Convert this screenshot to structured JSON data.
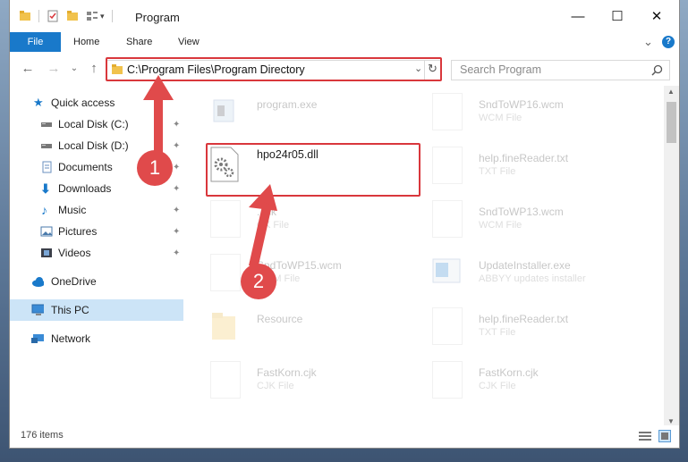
{
  "window": {
    "title": "Program",
    "controls": {
      "minimize": "—",
      "maximize": "☐",
      "close": "✕"
    }
  },
  "ribbon": {
    "tabs": [
      "File",
      "Home",
      "Share",
      "View"
    ],
    "help": "?",
    "expand": "⌄"
  },
  "navigation": {
    "back": "←",
    "forward": "→",
    "recent": "⌄",
    "up": "↑",
    "address": "C:\\Program Files\\Program Directory",
    "refresh": "↻",
    "address_dropdown": "⌄",
    "search_placeholder": "Search Program"
  },
  "sidebar": {
    "items": [
      {
        "label": "Quick access",
        "icon": "star-icon"
      },
      {
        "label": "Local Disk (C:)",
        "icon": "drive-icon",
        "pinned": true
      },
      {
        "label": "Local Disk (D:)",
        "icon": "drive-icon",
        "pinned": true
      },
      {
        "label": "Documents",
        "icon": "documents-icon",
        "pinned": true
      },
      {
        "label": "Downloads",
        "icon": "download-arrow-icon",
        "pinned": true
      },
      {
        "label": "Music",
        "icon": "music-note-icon",
        "pinned": true
      },
      {
        "label": "Pictures",
        "icon": "pictures-icon",
        "pinned": true
      },
      {
        "label": "Videos",
        "icon": "film-icon",
        "pinned": true
      },
      {
        "label": "OneDrive",
        "icon": "cloud-icon"
      },
      {
        "label": "This PC",
        "icon": "computer-icon",
        "selected": true
      },
      {
        "label": "Network",
        "icon": "network-icon"
      }
    ],
    "pin_glyph": "📌"
  },
  "files": [
    {
      "name": "program.exe",
      "type": "",
      "faded": true
    },
    {
      "name": "SndToWP16.wcm",
      "type": "WCM File",
      "faded": true
    },
    {
      "name": "hpo24r05.dll",
      "type": "",
      "faded": false,
      "highlighted": true
    },
    {
      "name": "help.fineReader.txt",
      "type": "TXT File",
      "faded": true
    },
    {
      "name": "...ck",
      "type": "CK File",
      "faded": true
    },
    {
      "name": "SndToWP13.wcm",
      "type": "WCM File",
      "faded": true
    },
    {
      "name": "SndToWP15.wcm",
      "type": "WCM File",
      "faded": true
    },
    {
      "name": "UpdateInstaller.exe",
      "type": "ABBYY updates installer",
      "faded": true
    },
    {
      "name": "Resource",
      "type": "",
      "faded": true
    },
    {
      "name": "help.fineReader.txt",
      "type": "TXT File",
      "faded": true
    },
    {
      "name": "FastKorn.cjk",
      "type": "CJK File",
      "faded": true
    },
    {
      "name": "FastKorn.cjk",
      "type": "CJK File",
      "faded": true
    }
  ],
  "status": {
    "item_count": "176 items"
  },
  "annotations": {
    "step1": "1",
    "step2": "2",
    "color": "#e04a4b"
  }
}
